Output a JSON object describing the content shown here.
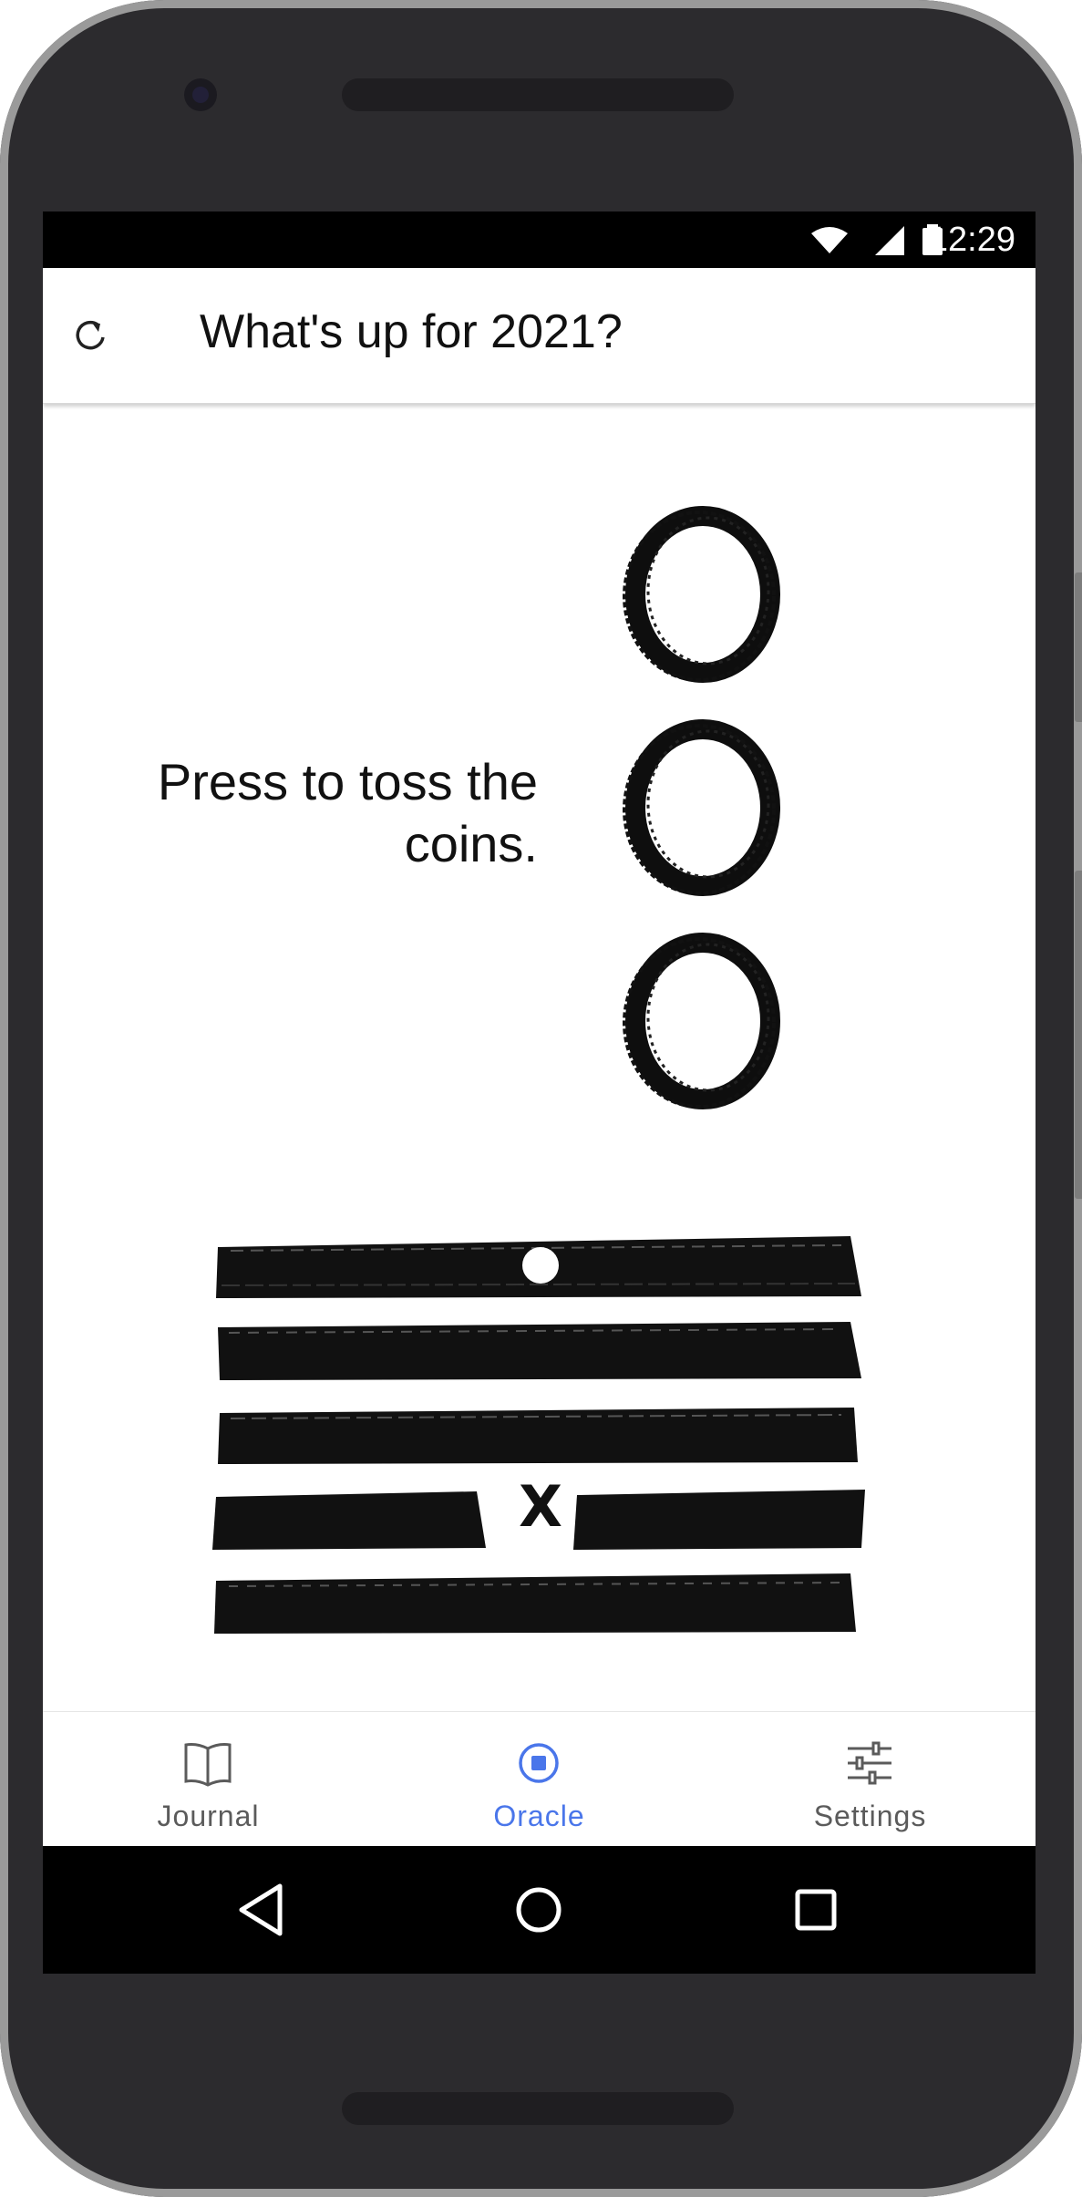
{
  "status_bar": {
    "time": "12:29"
  },
  "app_bar": {
    "title": "What's up for 2021?",
    "refresh_icon": "refresh-icon"
  },
  "oracle": {
    "prompt": "Press to toss the coins.",
    "coins": [
      "coin-1",
      "coin-2",
      "coin-3"
    ],
    "hexagram_lines": [
      {
        "kind": "yang",
        "marker": "dot"
      },
      {
        "kind": "yang",
        "marker": ""
      },
      {
        "kind": "yang",
        "marker": ""
      },
      {
        "kind": "yin",
        "marker": "X"
      },
      {
        "kind": "yang",
        "marker": ""
      }
    ]
  },
  "bottom_nav": {
    "items": [
      {
        "label": "Journal",
        "icon": "book-icon",
        "active": false
      },
      {
        "label": "Oracle",
        "icon": "oracle-icon",
        "active": true
      },
      {
        "label": "Settings",
        "icon": "sliders-icon",
        "active": false
      }
    ]
  },
  "colors": {
    "accent": "#4a76ea",
    "ink": "#111111",
    "inactive_nav": "#5b5b5b"
  }
}
